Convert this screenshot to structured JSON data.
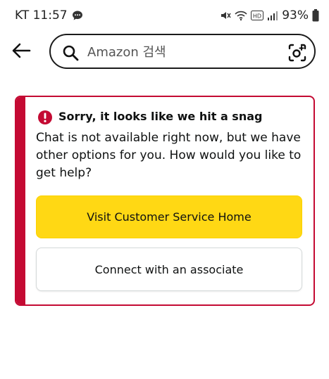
{
  "status_bar": {
    "carrier_time": "KT 11:57",
    "battery": "93%",
    "icons": [
      "chat-bubble-icon",
      "mute-icon",
      "wifi-icon",
      "hd-icon",
      "signal-icon",
      "battery-icon"
    ]
  },
  "header": {
    "back_icon": "arrow-left-icon",
    "search_placeholder": "Amazon 검색",
    "camera_icon": "camera-search-icon"
  },
  "alert": {
    "accent_color": "#c40a33",
    "icon": "error-icon",
    "title": "Sorry, it looks like we hit a snag",
    "message": "Chat is not available right now, but we have other options for you. How would you like to get help?",
    "primary_button": "Visit Customer Service Home",
    "secondary_button": "Connect with an associate",
    "primary_color": "#ffd814"
  }
}
